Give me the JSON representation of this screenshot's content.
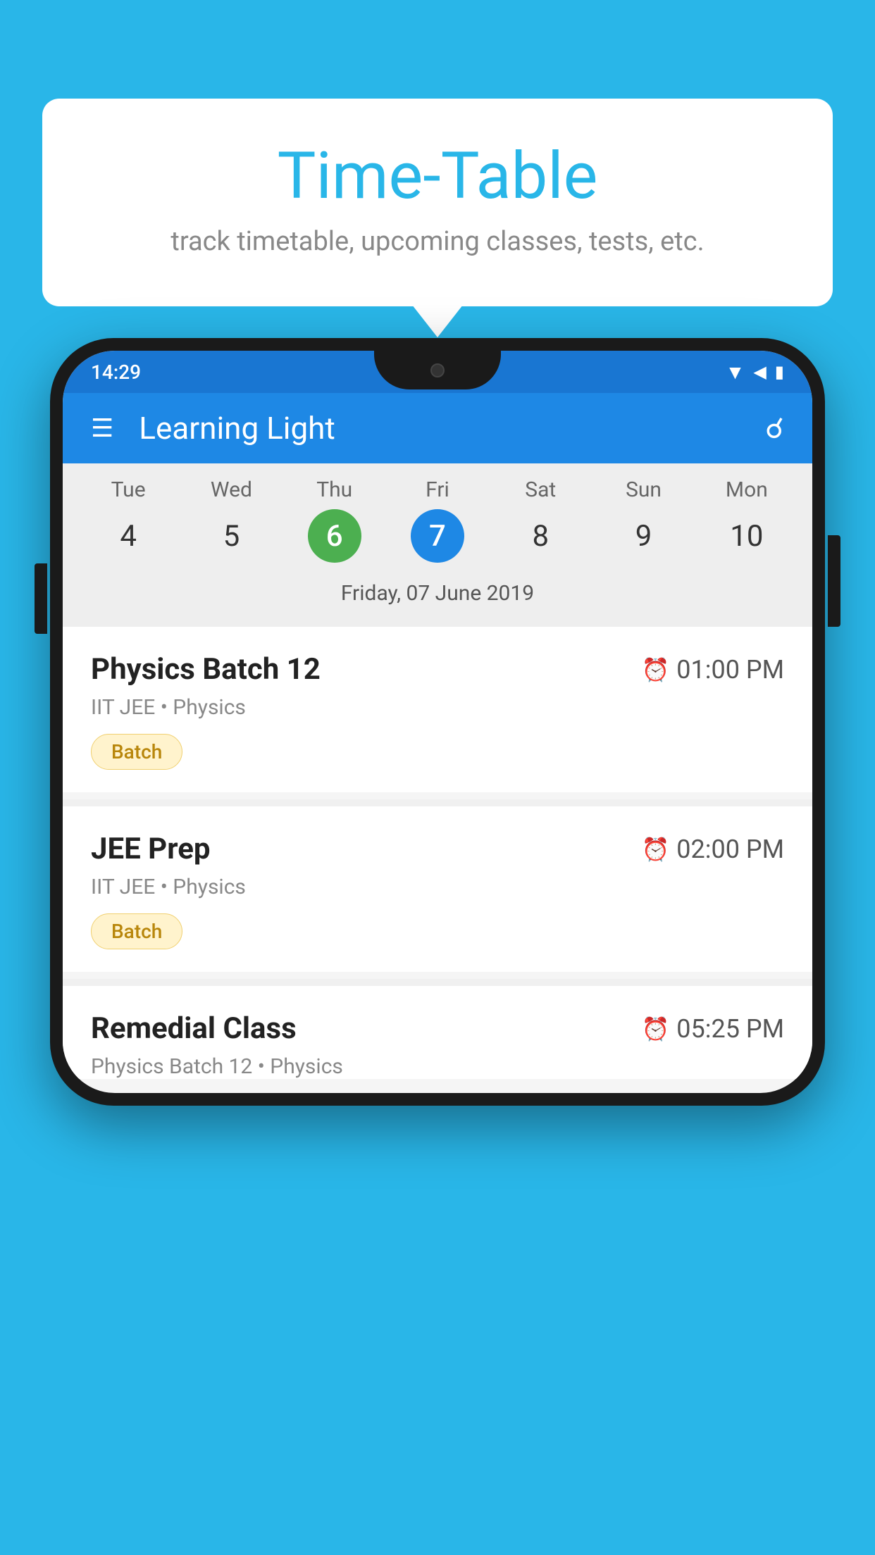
{
  "background_color": "#29b6e8",
  "bubble": {
    "title": "Time-Table",
    "subtitle": "track timetable, upcoming classes, tests, etc."
  },
  "phone": {
    "status_bar": {
      "time": "14:29",
      "icons": [
        "wifi",
        "signal",
        "battery"
      ]
    },
    "app_bar": {
      "title": "Learning Light",
      "has_hamburger": true,
      "has_search": true
    },
    "calendar": {
      "days": [
        {
          "name": "Tue",
          "num": "4",
          "state": "normal"
        },
        {
          "name": "Wed",
          "num": "5",
          "state": "normal"
        },
        {
          "name": "Thu",
          "num": "6",
          "state": "today"
        },
        {
          "name": "Fri",
          "num": "7",
          "state": "selected"
        },
        {
          "name": "Sat",
          "num": "8",
          "state": "normal"
        },
        {
          "name": "Sun",
          "num": "9",
          "state": "normal"
        },
        {
          "name": "Mon",
          "num": "10",
          "state": "normal"
        }
      ],
      "selected_date_label": "Friday, 07 June 2019"
    },
    "schedule": [
      {
        "title": "Physics Batch 12",
        "time": "01:00 PM",
        "subtitle": "IIT JEE • Physics",
        "badge": "Batch"
      },
      {
        "title": "JEE Prep",
        "time": "02:00 PM",
        "subtitle": "IIT JEE • Physics",
        "badge": "Batch"
      },
      {
        "title": "Remedial Class",
        "time": "05:25 PM",
        "subtitle": "Physics Batch 12 • Physics",
        "badge": null
      }
    ]
  }
}
